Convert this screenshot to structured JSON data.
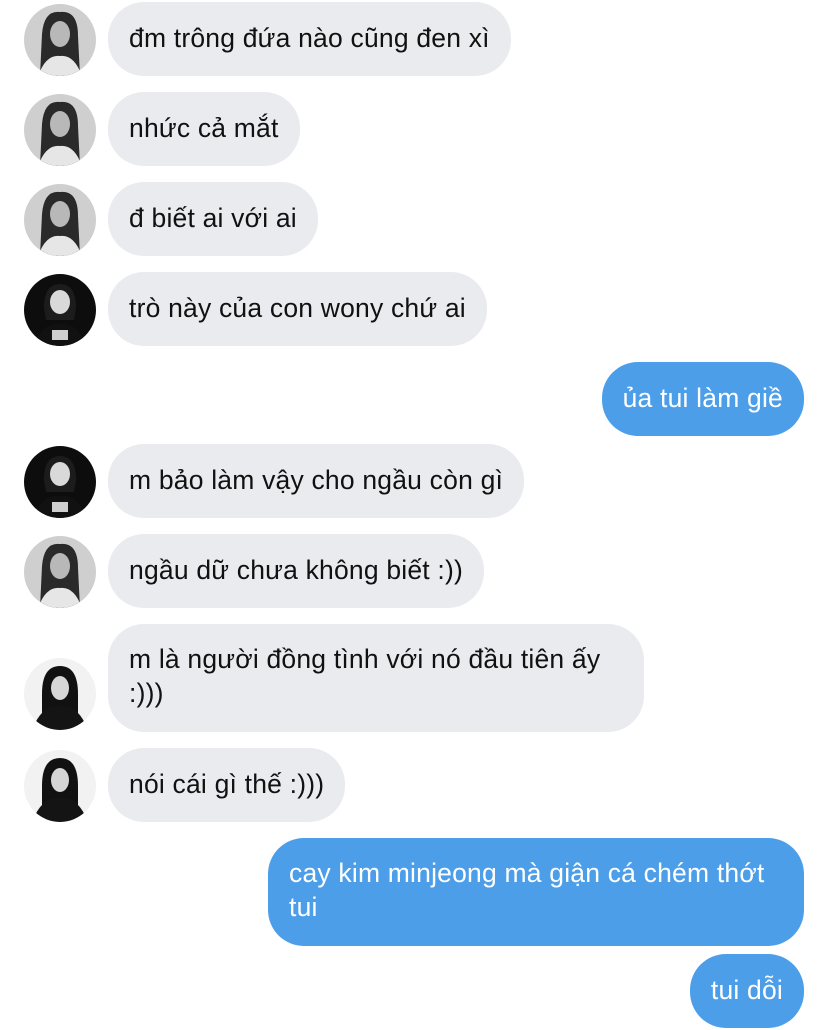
{
  "colors": {
    "incoming_bubble": "#e9ebee",
    "outgoing_bubble": "#4c9ee8"
  },
  "messages": [
    {
      "side": "incoming",
      "avatar": "avatar-girl-grayscale-icon",
      "text": "đm trông đứa nào cũng đen xì"
    },
    {
      "side": "incoming",
      "avatar": "avatar-girl-grayscale-icon",
      "text": "nhức cả mắt"
    },
    {
      "side": "incoming",
      "avatar": "avatar-girl-grayscale-icon",
      "text": "đ biết ai với ai"
    },
    {
      "side": "incoming",
      "avatar": "avatar-girl-dark-shirt-icon",
      "text": "trò này của con wony chứ ai"
    },
    {
      "side": "outgoing",
      "text": "ủa tui làm giề"
    },
    {
      "side": "incoming",
      "avatar": "avatar-girl-dark-shirt-icon",
      "text": "m bảo làm vậy cho ngầu còn gì"
    },
    {
      "side": "incoming",
      "avatar": "avatar-girl-grayscale-icon",
      "text": "ngầu dữ chưa không biết :))"
    },
    {
      "side": "incoming",
      "avatar": "avatar-girl-black-outfit-icon",
      "text": "m là người đồng tình với nó đầu tiên ấy :)))"
    },
    {
      "side": "incoming",
      "avatar": "avatar-girl-black-outfit-icon",
      "text": "nói cái gì thế :)))"
    },
    {
      "side": "outgoing",
      "text": "cay kim minjeong mà giận cá chém thớt tui"
    },
    {
      "side": "outgoing",
      "text": "tui dỗi"
    }
  ]
}
